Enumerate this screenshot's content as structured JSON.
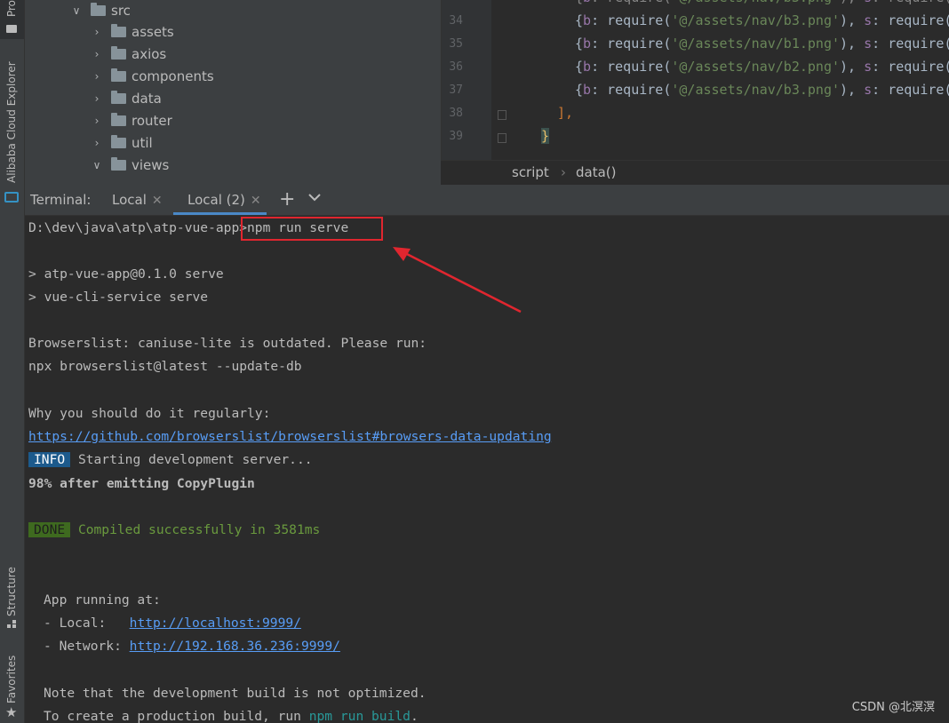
{
  "sidebar": {
    "project_label": "Pro",
    "cloud_label": "Alibaba Cloud Explorer",
    "structure_label": "Structure",
    "favorites_label": "Favorites"
  },
  "project_tree": {
    "items": [
      {
        "label": "src",
        "expanded": true
      },
      {
        "label": "assets",
        "expanded": false
      },
      {
        "label": "axios",
        "expanded": false
      },
      {
        "label": "components",
        "expanded": false
      },
      {
        "label": "data",
        "expanded": false
      },
      {
        "label": "router",
        "expanded": false
      },
      {
        "label": "util",
        "expanded": false
      },
      {
        "label": "views",
        "expanded": true
      }
    ]
  },
  "editor": {
    "line_numbers": [
      "34",
      "35",
      "36",
      "37",
      "38",
      "39"
    ],
    "lines": [
      {
        "key": "b",
        "path": "'@/assets/nav/b3.png'"
      },
      {
        "key": "b",
        "path": "'@/assets/nav/b1.png'"
      },
      {
        "key": "b",
        "path": "'@/assets/nav/b2.png'"
      },
      {
        "key": "b",
        "path": "'@/assets/nav/b3.png'"
      }
    ],
    "require_text": "require(",
    "s_key": "s",
    "close_bracket": "],",
    "close_brace": "}",
    "breadcrumb": [
      "script",
      "data()"
    ]
  },
  "terminal": {
    "label": "Terminal:",
    "tabs": [
      {
        "label": "Local",
        "active": false
      },
      {
        "label": "Local (2)",
        "active": true
      }
    ],
    "add_symbol": "+",
    "prompt": "D:\\dev\\java\\atp\\atp-vue-app>",
    "command": "npm run serve",
    "output": {
      "script_line1": "> atp-vue-app@0.1.0 serve",
      "script_line2": "> vue-cli-service serve",
      "browserslist_line1": "Browserslist: caniuse-lite is outdated. Please run:",
      "browserslist_line2": "npx browserslist@latest --update-db",
      "why_line": "Why you should do it regularly:",
      "why_link": "https://github.com/browserslist/browserslist#browsers-data-updating",
      "info_badge": "INFO",
      "info_text": "Starting development server...",
      "progress_line": "98% after emitting CopyPlugin",
      "done_badge": "DONE",
      "done_text": "Compiled successfully in 3581ms",
      "app_running": "App running at:",
      "local_label": "- Local:",
      "local_url": "http://localhost:9999/",
      "network_label": "- Network:",
      "network_url": "http://192.168.36.236:9999/",
      "note_line": "Note that the development build is not optimized.",
      "create_prefix": "To create a production build, run ",
      "create_cmd": "npm run build",
      "create_suffix": "."
    }
  },
  "annotation": {
    "color": "#e0262f"
  },
  "watermark": "CSDN @北溟溟"
}
